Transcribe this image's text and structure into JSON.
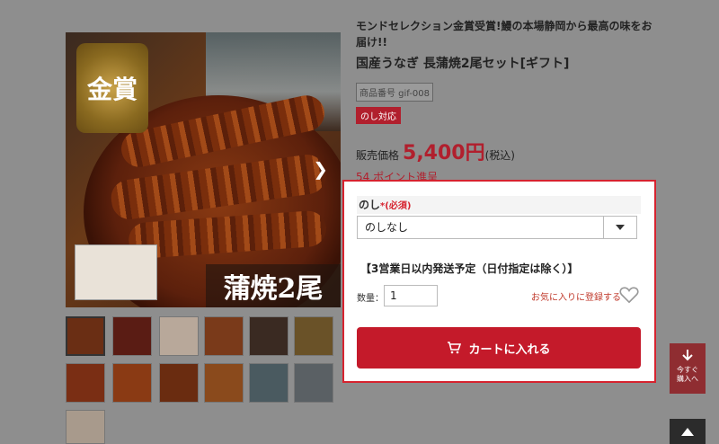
{
  "product": {
    "catch_copy": "モンドセレクション金賞受賞!鰻の本場静岡から最高の味をお届け!!",
    "title": "国産うなぎ 長蒲焼2尾セット[ギフト]",
    "code": "商品番号 gif-008",
    "noshi_badge": "のし対応",
    "price_label": "販売価格",
    "price": "5,400円",
    "tax": "(税込)",
    "points": "54 ポイント進呈"
  },
  "image": {
    "medal_text": "金賞",
    "banner_text": "蒲焼2尾"
  },
  "options": {
    "noshi_label": "のし",
    "required": "*(必須)",
    "noshi_selected": "のしなし",
    "shipping_note": "【3営業日以内発送予定（日付指定は除く）】",
    "qty_label": "数量：",
    "qty_value": "1",
    "favorite_label": "お気に入りに登録する",
    "cart_button": "カートに入れる"
  },
  "floating": {
    "buy_now": "今すぐ購入へ"
  },
  "colors": {
    "accent": "#c41a2a",
    "price": "#b11f2d"
  }
}
